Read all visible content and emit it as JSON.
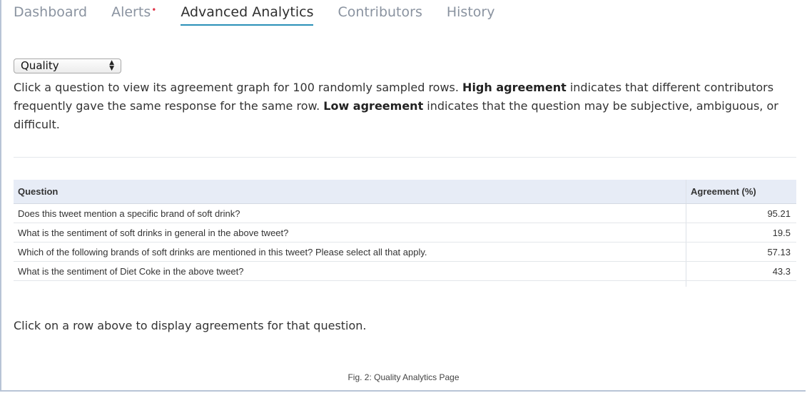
{
  "tabs": [
    {
      "label": "Dashboard"
    },
    {
      "label": "Alerts",
      "badge": "•"
    },
    {
      "label": "Advanced Analytics",
      "active": true
    },
    {
      "label": "Contributors"
    },
    {
      "label": "History"
    }
  ],
  "select": {
    "value": "Quality",
    "arrows": "▲\n▼"
  },
  "description": {
    "part1": "Click a question to view its agreement graph for 100 randomly sampled rows. ",
    "bold1": "High agreement",
    "part2": " indicates that different contributors frequently gave the same response for the same row. ",
    "bold2": "Low agreement",
    "part3": " indicates that the question may be subjective, ambiguous, or difficult."
  },
  "table": {
    "headers": [
      "Question",
      "Agreement (%)"
    ],
    "rows": [
      {
        "question": "Does this tweet mention a specific brand of soft drink?",
        "agreement": "95.21"
      },
      {
        "question": "What is the sentiment of soft drinks in general in the above tweet?",
        "agreement": "19.5"
      },
      {
        "question": "Which of the following brands of soft drinks are mentioned in this tweet? Please select all that apply.",
        "agreement": "57.13"
      },
      {
        "question": "What is the sentiment of Diet Coke in the above tweet?",
        "agreement": "43.3"
      }
    ]
  },
  "note": "Click on a row above to display agreements for that question.",
  "caption": "Fig. 2: Quality Analytics Page",
  "colors": {
    "accent": "#2a90b8",
    "alert": "#e0364b",
    "header_bg": "#e7ecf6"
  }
}
